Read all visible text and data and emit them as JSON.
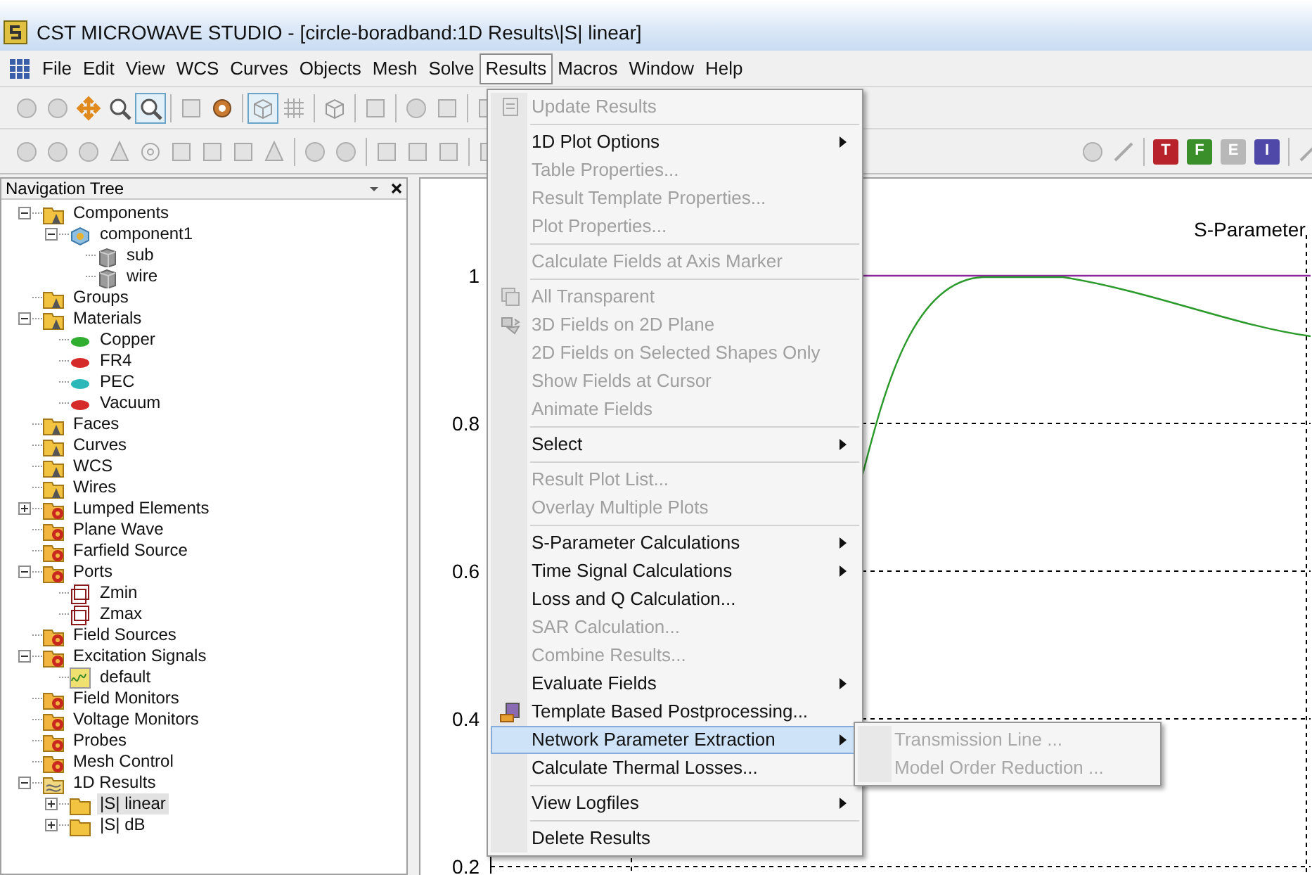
{
  "window": {
    "title": "CST MICROWAVE STUDIO - [circle-boradband:1D Results\\|S| linear]"
  },
  "menubar": [
    {
      "label": "File",
      "selected": false
    },
    {
      "label": "Edit",
      "selected": false
    },
    {
      "label": "View",
      "selected": false
    },
    {
      "label": "WCS",
      "selected": false
    },
    {
      "label": "Curves",
      "selected": false
    },
    {
      "label": "Objects",
      "selected": false
    },
    {
      "label": "Mesh",
      "selected": false
    },
    {
      "label": "Solve",
      "selected": false
    },
    {
      "label": "Results",
      "selected": true
    },
    {
      "label": "Macros",
      "selected": false
    },
    {
      "label": "Window",
      "selected": false
    },
    {
      "label": "Help",
      "selected": false
    }
  ],
  "toolbar_letters": [
    {
      "label": "T",
      "color": "#b8232b"
    },
    {
      "label": "F",
      "color": "#3a8f2a"
    },
    {
      "label": "E",
      "color": "#b8b8b8"
    },
    {
      "label": "I",
      "color": "#5048a8"
    }
  ],
  "navigation": {
    "title": "Navigation Tree",
    "tree": [
      {
        "label": "Components",
        "kind": "folder",
        "expanded": true,
        "selected": false,
        "children": [
          {
            "label": "component1",
            "kind": "component",
            "expanded": true,
            "selected": false,
            "children": [
              {
                "label": "sub",
                "kind": "solid",
                "selected": false
              },
              {
                "label": "wire",
                "kind": "solid",
                "selected": false
              }
            ]
          }
        ]
      },
      {
        "label": "Groups",
        "kind": "folder",
        "selected": false
      },
      {
        "label": "Materials",
        "kind": "folder",
        "expanded": true,
        "selected": false,
        "children": [
          {
            "label": "Copper",
            "kind": "material",
            "color": "#2fae2f",
            "selected": false
          },
          {
            "label": "FR4",
            "kind": "material",
            "color": "#d42a2a",
            "selected": false
          },
          {
            "label": "PEC",
            "kind": "material",
            "color": "#2cb8b8",
            "selected": false
          },
          {
            "label": "Vacuum",
            "kind": "material",
            "color": "#d42a2a",
            "selected": false
          }
        ]
      },
      {
        "label": "Faces",
        "kind": "folder",
        "selected": false
      },
      {
        "label": "Curves",
        "kind": "folder",
        "selected": false
      },
      {
        "label": "WCS",
        "kind": "folder",
        "selected": false
      },
      {
        "label": "Wires",
        "kind": "folder",
        "selected": false
      },
      {
        "label": "Lumped Elements",
        "kind": "source",
        "expanded": false,
        "selected": false
      },
      {
        "label": "Plane Wave",
        "kind": "source",
        "selected": false
      },
      {
        "label": "Farfield Source",
        "kind": "source",
        "selected": false
      },
      {
        "label": "Ports",
        "kind": "source",
        "expanded": true,
        "selected": false,
        "children": [
          {
            "label": "Zmin",
            "kind": "port",
            "selected": false
          },
          {
            "label": "Zmax",
            "kind": "port",
            "selected": false
          }
        ]
      },
      {
        "label": "Field Sources",
        "kind": "source",
        "selected": false
      },
      {
        "label": "Excitation Signals",
        "kind": "source",
        "expanded": true,
        "selected": false,
        "children": [
          {
            "label": "default",
            "kind": "signal",
            "selected": false
          }
        ]
      },
      {
        "label": "Field Monitors",
        "kind": "source",
        "selected": false
      },
      {
        "label": "Voltage Monitors",
        "kind": "source",
        "selected": false
      },
      {
        "label": "Probes",
        "kind": "source",
        "selected": false
      },
      {
        "label": "Mesh Control",
        "kind": "source",
        "selected": false
      },
      {
        "label": "1D Results",
        "kind": "results",
        "expanded": true,
        "selected": false,
        "children": [
          {
            "label": "|S| linear",
            "kind": "result",
            "expanded": false,
            "selected": true
          },
          {
            "label": "|S| dB",
            "kind": "result",
            "expanded": false,
            "selected": false
          }
        ]
      }
    ]
  },
  "plot": {
    "title": "S-Parameter",
    "yticks": [
      "1",
      "0.8",
      "0.6",
      "0.4",
      "0.2"
    ]
  },
  "results_menu": [
    {
      "kind": "item",
      "label": "Update Results",
      "disabled": true,
      "submenu": false,
      "selected": false
    },
    {
      "kind": "separator"
    },
    {
      "kind": "item",
      "label": "1D Plot Options",
      "disabled": false,
      "submenu": true,
      "selected": false
    },
    {
      "kind": "item",
      "label": "Table Properties...",
      "disabled": true,
      "submenu": false,
      "selected": false
    },
    {
      "kind": "item",
      "label": "Result Template Properties...",
      "disabled": true,
      "submenu": false,
      "selected": false
    },
    {
      "kind": "item",
      "label": "Plot Properties...",
      "disabled": true,
      "submenu": false,
      "selected": false
    },
    {
      "kind": "separator"
    },
    {
      "kind": "item",
      "label": "Calculate Fields at Axis Marker",
      "disabled": true,
      "submenu": false,
      "selected": false
    },
    {
      "kind": "separator"
    },
    {
      "kind": "item",
      "label": "All Transparent",
      "disabled": true,
      "submenu": false,
      "selected": false
    },
    {
      "kind": "item",
      "label": "3D Fields on 2D Plane",
      "disabled": true,
      "submenu": false,
      "selected": false
    },
    {
      "kind": "item",
      "label": "2D Fields on Selected Shapes Only",
      "disabled": true,
      "submenu": false,
      "selected": false
    },
    {
      "kind": "item",
      "label": "Show Fields at Cursor",
      "disabled": true,
      "submenu": false,
      "selected": false
    },
    {
      "kind": "item",
      "label": "Animate Fields",
      "disabled": true,
      "submenu": false,
      "selected": false
    },
    {
      "kind": "separator"
    },
    {
      "kind": "item",
      "label": "Select",
      "disabled": false,
      "submenu": true,
      "selected": false
    },
    {
      "kind": "separator"
    },
    {
      "kind": "item",
      "label": "Result Plot List...",
      "disabled": true,
      "submenu": false,
      "selected": false
    },
    {
      "kind": "item",
      "label": "Overlay Multiple Plots",
      "disabled": true,
      "submenu": false,
      "selected": false
    },
    {
      "kind": "separator"
    },
    {
      "kind": "item",
      "label": "S-Parameter Calculations",
      "disabled": false,
      "submenu": true,
      "selected": false
    },
    {
      "kind": "item",
      "label": "Time Signal Calculations",
      "disabled": false,
      "submenu": true,
      "selected": false
    },
    {
      "kind": "item",
      "label": "Loss and Q Calculation...",
      "disabled": false,
      "submenu": false,
      "selected": false
    },
    {
      "kind": "item",
      "label": "SAR Calculation...",
      "disabled": true,
      "submenu": false,
      "selected": false
    },
    {
      "kind": "item",
      "label": "Combine Results...",
      "disabled": true,
      "submenu": false,
      "selected": false
    },
    {
      "kind": "item",
      "label": "Evaluate Fields",
      "disabled": false,
      "submenu": true,
      "selected": false
    },
    {
      "kind": "item",
      "label": "Template Based Postprocessing...",
      "disabled": false,
      "submenu": false,
      "selected": false
    },
    {
      "kind": "item",
      "label": "Network Parameter Extraction",
      "disabled": false,
      "submenu": true,
      "selected": true
    },
    {
      "kind": "item",
      "label": "Calculate Thermal Losses...",
      "disabled": false,
      "submenu": false,
      "selected": false
    },
    {
      "kind": "separator"
    },
    {
      "kind": "item",
      "label": "View Logfiles",
      "disabled": false,
      "submenu": true,
      "selected": false
    },
    {
      "kind": "separator"
    },
    {
      "kind": "item",
      "label": "Delete Results",
      "disabled": false,
      "submenu": false,
      "selected": false
    }
  ],
  "submenu": [
    {
      "label": "Transmission Line ...",
      "disabled": true
    },
    {
      "label": "Model Order Reduction ...",
      "disabled": true
    }
  ]
}
